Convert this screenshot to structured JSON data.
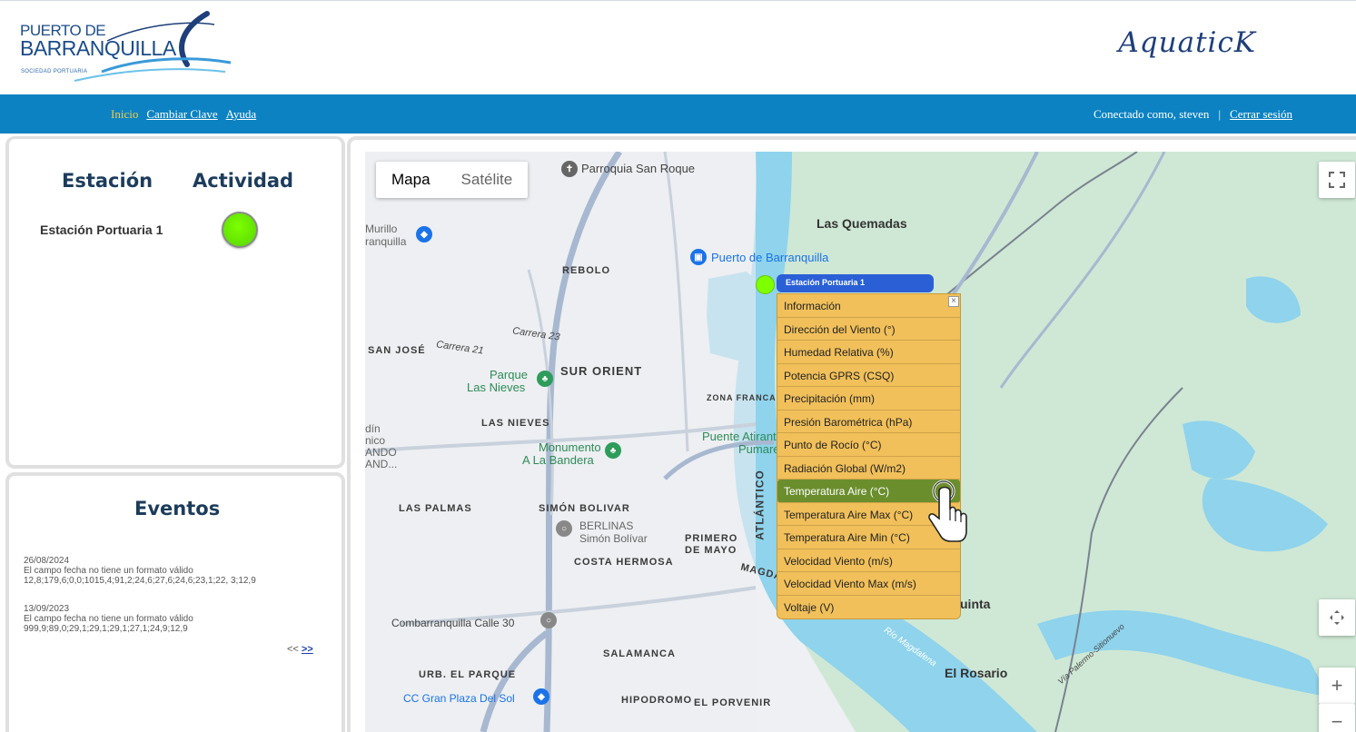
{
  "header": {
    "logo_line1": "PUERTO DE",
    "logo_line2": "BARRANQUILLA",
    "logo_line3": "SOCIEDAD PORTUARIA",
    "brand": "AquaticK"
  },
  "nav": {
    "links": [
      {
        "label": "Inicio"
      },
      {
        "label": "Cambiar Clave"
      },
      {
        "label": "Ayuda"
      }
    ],
    "connected": "Conectado como, steven",
    "separator": "|",
    "logout": "Cerrar sesión"
  },
  "station_panel": {
    "heading_station": "Estación",
    "heading_activity": "Actividad",
    "station_name": "Estación Portuaria 1",
    "activity_color": "#7dff00"
  },
  "events_panel": {
    "heading": "Eventos",
    "events": [
      {
        "date": "26/08/2024",
        "message": "El campo fecha no tiene un formato válido",
        "data": "12,8;179,6;0,0;1015,4;91,2;24,6;27,6;24,6;23,1;22, 3;12,9"
      },
      {
        "date": "13/09/2023",
        "message": "El campo fecha no tiene un formato válido",
        "data": "999,9;89,0;29,1;29,1;29,1;27,1;24,9;12,9"
      }
    ],
    "prev": "<<",
    "next": ">>"
  },
  "map": {
    "type_map": "Mapa",
    "type_satellite": "Satélite",
    "labels": {
      "parroquia": "Parroquia San Roque",
      "murillo1": "Murillo",
      "murillo2": "ranquilla",
      "las_quemadas": "Las Quemadas",
      "puerto": "Puerto de Barranquilla",
      "rebolo": "REBOLO",
      "san_jose": "SAN JOSÉ",
      "carrera21": "Carrera 21",
      "carrera23": "Carrera 23",
      "parque1": "Parque",
      "parque2": "Las Nieves",
      "sur_orient": "SUR ORIENT",
      "zona_franca": "ZONA FRANCA",
      "las_nieves": "LAS NIEVES",
      "monumento1": "Monumento",
      "monumento2": "A La Bandera",
      "puente": "Puente Atirantad",
      "pumarej": "Pumarej",
      "las_palmas": "LAS PALMAS",
      "simon": "SIMÓN BOLIVAR",
      "berlinas1": "BERLINAS",
      "berlinas2": "Simón Bolívar",
      "primero1": "PRIMERO",
      "primero2": "DE MAYO",
      "costa": "COSTA HERMOSA",
      "atlantico": "ATLÁNTICO",
      "magda": "MAGDA",
      "combarranquilla": "Combarranquilla Calle 30",
      "salamanca": "SALAMANCA",
      "urb": "URB. EL PARQUE",
      "cc": "CC Gran Plaza Del Sol",
      "hipodromo": "HIPODROMO",
      "porvenir": "EL PORVENIR",
      "el_rosario": "El Rosario",
      "uinta": "uinta",
      "rio": "Río Magdalena",
      "via": "Vía Palermo-Sitionuevo",
      "din1": "dín",
      "din2": "nico",
      "din3": "ANDO",
      "din4": "AND..."
    },
    "marker_label": "Estación Portuaria 1",
    "menu_items": [
      "Información",
      "Dirección del Viento (°)",
      "Humedad Relativa (%)",
      "Potencia GPRS (CSQ)",
      "Precipitación (mm)",
      "Presión Barométrica (hPa)",
      "Punto de Rocío (°C)",
      "Radiación Global (W/m2)",
      "Temperatura Aire (°C)",
      "Temperatura Aire Max (°C)",
      "Temperatura Aire Min (°C)",
      "Velocidad Viento (m/s)",
      "Velocidad Viento Max (m/s)",
      "Voltaje (V)"
    ],
    "selected_item": "Temperatura Aire (°C)",
    "zoom_in": "+",
    "zoom_out": "−"
  }
}
